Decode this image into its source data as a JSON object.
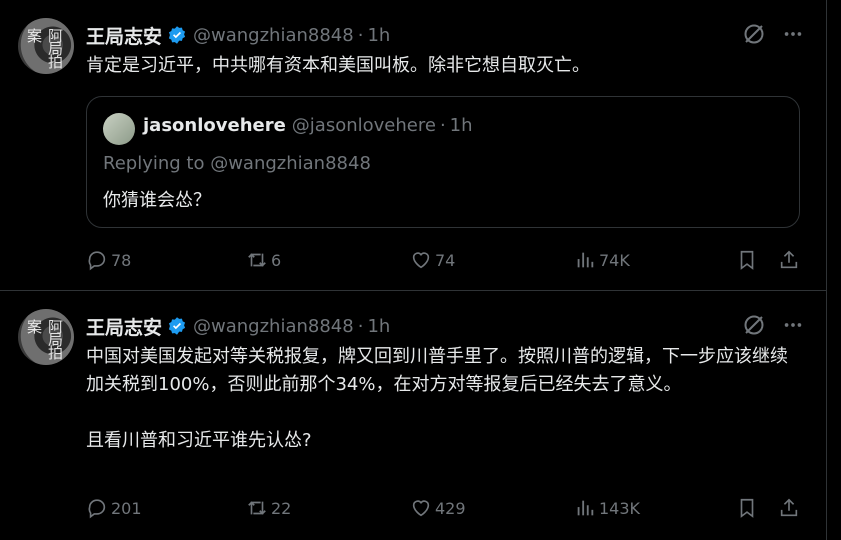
{
  "posts": [
    {
      "author": {
        "name": "王局志安",
        "handle": "@wangzhian8848",
        "time": "1h",
        "avatar_text": "阿局拍案"
      },
      "text": "肯定是习近平，中共哪有资本和美国叫板。除非它想自取灭亡。",
      "quote": {
        "name": "jasonlovehere",
        "handle": "@jasonlovehere",
        "time": "1h",
        "replying": "Replying to @wangzhian8848",
        "text": "你猜谁会怂？"
      },
      "stats": {
        "replies": "78",
        "reposts": "6",
        "likes": "74",
        "views": "74K"
      }
    },
    {
      "author": {
        "name": "王局志安",
        "handle": "@wangzhian8848",
        "time": "1h",
        "avatar_text": "阿局拍案"
      },
      "text": "中国对美国发起对等关税报复，牌又回到川普手里了。按照川普的逻辑，下一步应该继续加关税到100%，否则此前那个34%，在对方对等报复后已经失去了意义。\n\n且看川普和习近平谁先认怂?",
      "stats": {
        "replies": "201",
        "reposts": "22",
        "likes": "429",
        "views": "143K"
      }
    }
  ],
  "separator": "·",
  "icons": [
    "verified-badge-icon",
    "grok-icon",
    "more-icon",
    "reply-icon",
    "repost-icon",
    "like-icon",
    "views-icon",
    "bookmark-icon",
    "share-icon"
  ],
  "colors": {
    "background": "#000000",
    "text": "#e7e9ea",
    "muted": "#71767b",
    "border": "#2f3336",
    "verified": "#1d9bf0"
  }
}
